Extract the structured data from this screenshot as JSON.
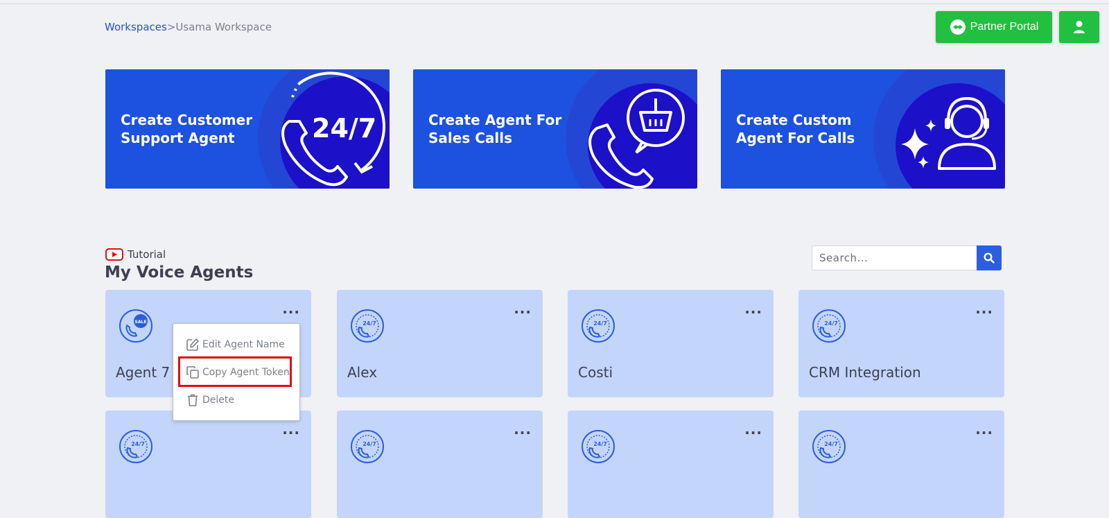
{
  "breadcrumb": {
    "link": "Workspaces",
    "current": ">Usama Workspace"
  },
  "header": {
    "partner_portal_label": "Partner Portal",
    "user_icon": "user-icon"
  },
  "colors": {
    "green": "#22c041",
    "banner_blue": "#1d52e0",
    "card_blue": "#c3d5fb",
    "accent": "#2b5ee0",
    "highlight": "#e01010"
  },
  "banners": [
    {
      "title": "Create Customer\nSupport Agent",
      "icon": "24-7-phone-icon",
      "icon_text": "24/7"
    },
    {
      "title": "Create Agent For\nSales Calls",
      "icon": "phone-basket-icon"
    },
    {
      "title": "Create Custom\nAgent For Calls",
      "icon": "headset-agent-icon"
    }
  ],
  "tutorial": {
    "label": "Tutorial",
    "icon": "youtube-icon"
  },
  "section_title": "My Voice Agents",
  "search": {
    "placeholder": "Search..."
  },
  "agents": [
    {
      "name": "Agent 7 -",
      "icon": "sale-phone-icon"
    },
    {
      "name": "Alex",
      "icon": "24-7-phone-icon"
    },
    {
      "name": "Costi",
      "icon": "24-7-phone-icon"
    },
    {
      "name": "CRM Integration",
      "icon": "24-7-phone-icon"
    },
    {
      "name": "",
      "icon": "24-7-phone-icon"
    },
    {
      "name": "",
      "icon": "24-7-phone-icon"
    },
    {
      "name": "",
      "icon": "24-7-phone-icon"
    },
    {
      "name": "",
      "icon": "24-7-phone-icon"
    }
  ],
  "dropdown": {
    "edit": "Edit Agent Name",
    "copy": "Copy Agent Token",
    "delete": "Delete"
  },
  "small_icon_text": {
    "sale": "SALE",
    "hours": "24/7"
  }
}
